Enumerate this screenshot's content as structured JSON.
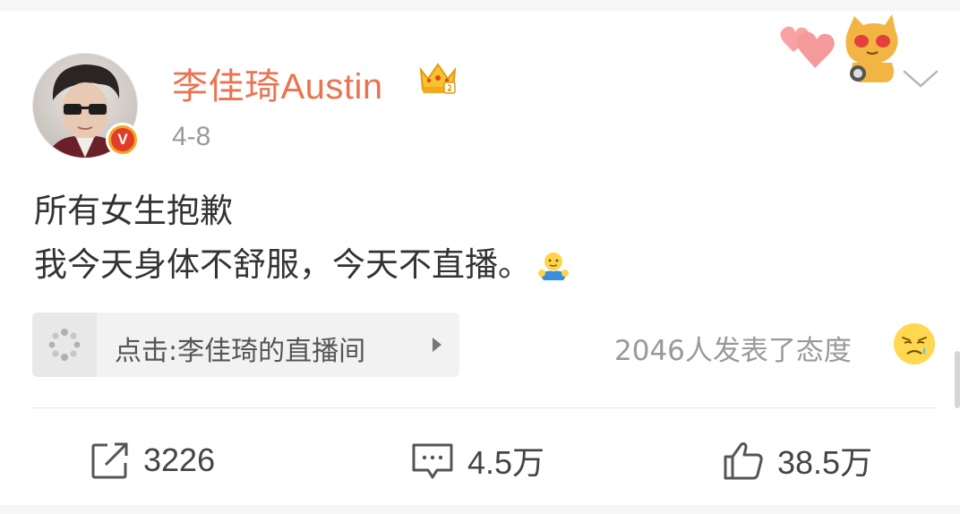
{
  "post": {
    "username": "李佳琦Austin",
    "time": "4-8",
    "content_lines": [
      "所有女生抱歉",
      "我今天身体不舒服，今天不直播。"
    ],
    "verified_badge": "V"
  },
  "live_link": {
    "label": "点击:李佳琦的直播间",
    "icon": "live-loading-icon"
  },
  "attitude": {
    "text": "2046人发表了态度",
    "icon": "sad-face-emoji"
  },
  "actions": {
    "repost_count": "3226",
    "comment_count": "4.5万",
    "like_count": "38.5万"
  },
  "colors": {
    "username": "#eb7350",
    "text": "#333333",
    "muted": "#999999",
    "badge_orange": "#f5a623",
    "badge_red": "#e23d2a"
  }
}
